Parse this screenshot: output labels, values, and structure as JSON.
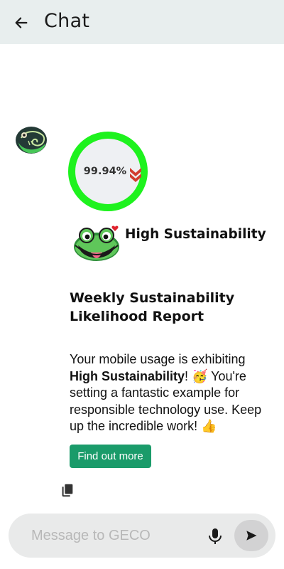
{
  "header": {
    "title": "Chat",
    "back_icon": "arrow-left-icon"
  },
  "bot": {
    "avatar_icon": "chameleon-avatar-icon"
  },
  "gauge": {
    "value": "99.94%",
    "trend_icon": "double-chevron-down-icon",
    "ring_color": "#1ef21e",
    "trend_color": "#d23b2e"
  },
  "status": {
    "label": "High Sustainability",
    "mascot_icon": "frog-mascot-icon",
    "heart_icon": "heart-icon"
  },
  "report": {
    "title": "Weekly Sustainability Likelihood Report",
    "message_prefix": "Your mobile usage is exhibiting ",
    "message_bold": "High Sustainability",
    "message_suffix": "! 🥳 You're setting a fantastic example for responsible technology use. Keep up the incredible work! 👍"
  },
  "actions": {
    "find_out_more": "Find out more",
    "copy_icon": "copy-icon",
    "button_color": "#1a9b6a"
  },
  "composer": {
    "placeholder": "Message to GECO",
    "mic_icon": "microphone-icon",
    "send_icon": "send-icon"
  }
}
